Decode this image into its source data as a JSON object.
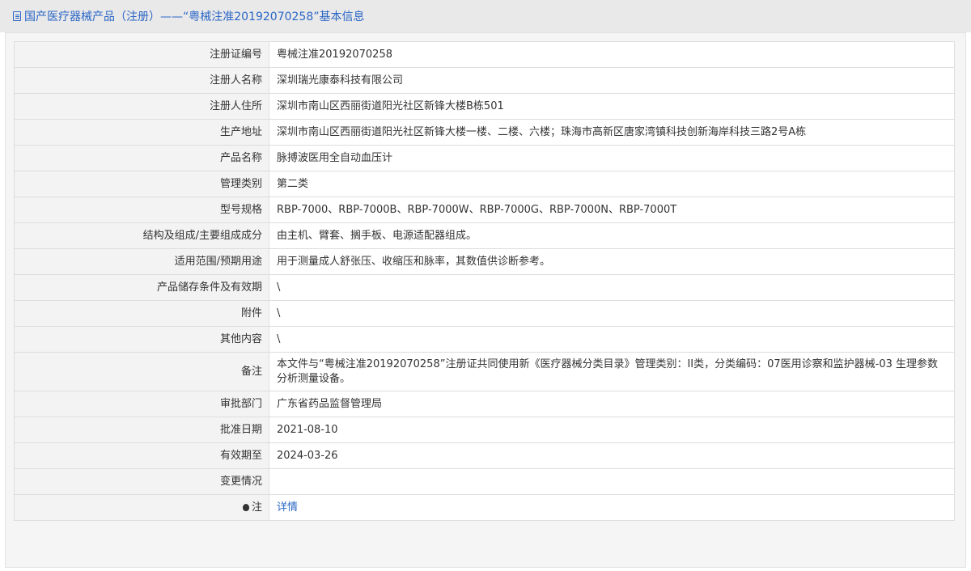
{
  "title": "国产医疗器械产品（注册）——“粤械注准20192070258”基本信息",
  "rows": [
    {
      "key": "注册证编号",
      "value": "粤械注准20192070258"
    },
    {
      "key": "注册人名称",
      "value": "深圳瑞光康泰科技有限公司"
    },
    {
      "key": "注册人住所",
      "value": "深圳市南山区西丽街道阳光社区新锋大楼B栋501"
    },
    {
      "key": "生产地址",
      "value": "深圳市南山区西丽街道阳光社区新锋大楼一楼、二楼、六楼；珠海市高新区唐家湾镇科技创新海岸科技三路2号A栋"
    },
    {
      "key": "产品名称",
      "value": "脉搏波医用全自动血压计"
    },
    {
      "key": "管理类别",
      "value": "第二类"
    },
    {
      "key": "型号规格",
      "value": "RBP-7000、RBP-7000B、RBP-7000W、RBP-7000G、RBP-7000N、RBP-7000T"
    },
    {
      "key": "结构及组成/主要组成成分",
      "value": "由主机、臂套、搁手板、电源适配器组成。"
    },
    {
      "key": "适用范围/预期用途",
      "value": "用于测量成人舒张压、收缩压和脉率，其数值供诊断参考。"
    },
    {
      "key": "产品储存条件及有效期",
      "value": "\\"
    },
    {
      "key": "附件",
      "value": "\\"
    },
    {
      "key": "其他内容",
      "value": "\\"
    },
    {
      "key": "备注",
      "value": "本文件与“粤械注准20192070258”注册证共同使用新《医疗器械分类目录》管理类别：II类，分类编码：07医用诊察和监护器械-03 生理参数分析测量设备。"
    },
    {
      "key": "审批部门",
      "value": "广东省药品监督管理局"
    },
    {
      "key": "批准日期",
      "value": "2021-08-10"
    },
    {
      "key": "有效期至",
      "value": "2024-03-26"
    },
    {
      "key": "变更情况",
      "value": ""
    },
    {
      "key": "注",
      "value": "详情"
    }
  ],
  "icons": {
    "title": "document-icon",
    "note": "lightbulb-icon"
  },
  "colors": {
    "link": "#2a66c6",
    "header_bg": "#e9e9e9",
    "key_bg": "#f3f3f3"
  }
}
